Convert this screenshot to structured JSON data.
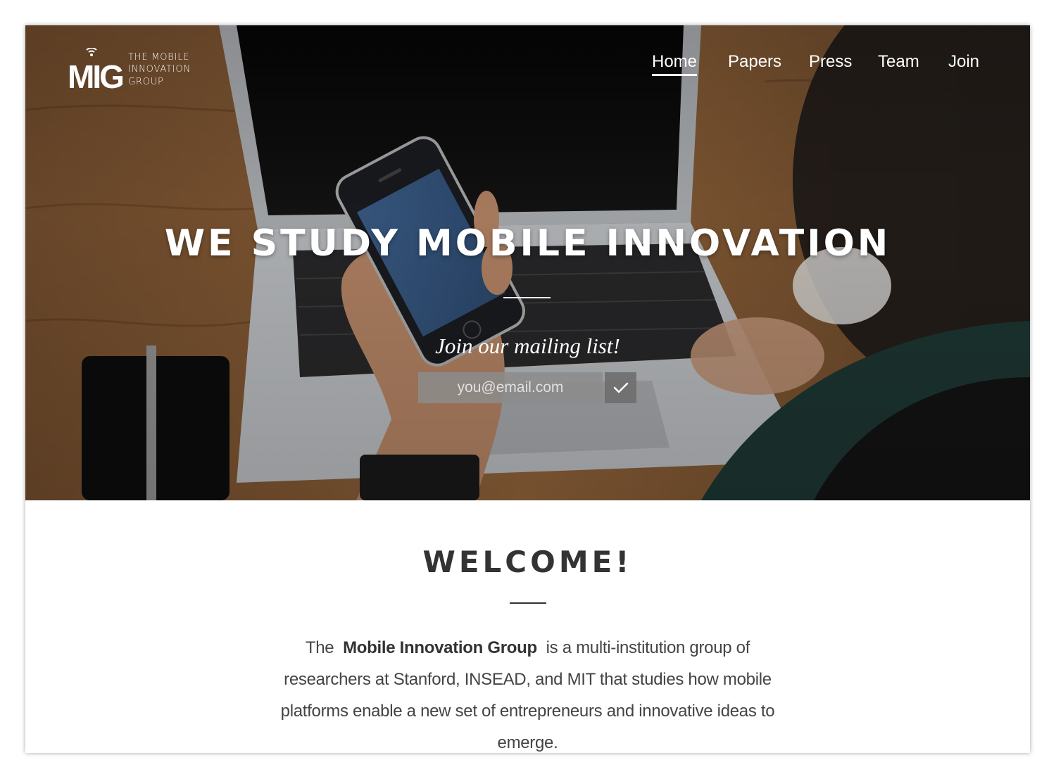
{
  "logo": {
    "mark_letters": "MIG",
    "line1": "THE MOBILE",
    "line2": "INNOVATION",
    "line3": "GROUP"
  },
  "nav": {
    "items": [
      {
        "label": "Home",
        "active": true
      },
      {
        "label": "Papers",
        "active": false
      },
      {
        "label": "Press",
        "active": false
      },
      {
        "label": "Team",
        "active": false
      },
      {
        "label": "Join",
        "active": false
      }
    ]
  },
  "hero": {
    "headline": "WE STUDY MOBILE INNOVATION",
    "mailing_title": "Join our mailing list!",
    "email_placeholder": "you@email.com",
    "submit_icon": "checkmark-icon"
  },
  "welcome": {
    "title": "WELCOME!",
    "text_before": "The",
    "text_bold": "Mobile Innovation Group",
    "text_after": "is a multi-institution group of researchers at Stanford, INSEAD, and MIT that studies how mobile platforms enable a new set of entrepreneurs and innovative ideas to emerge."
  },
  "colors": {
    "heading": "#333333",
    "body_text": "#444444",
    "input_bg": "#8c8c8c",
    "submit_bg": "#6e6e6e"
  }
}
